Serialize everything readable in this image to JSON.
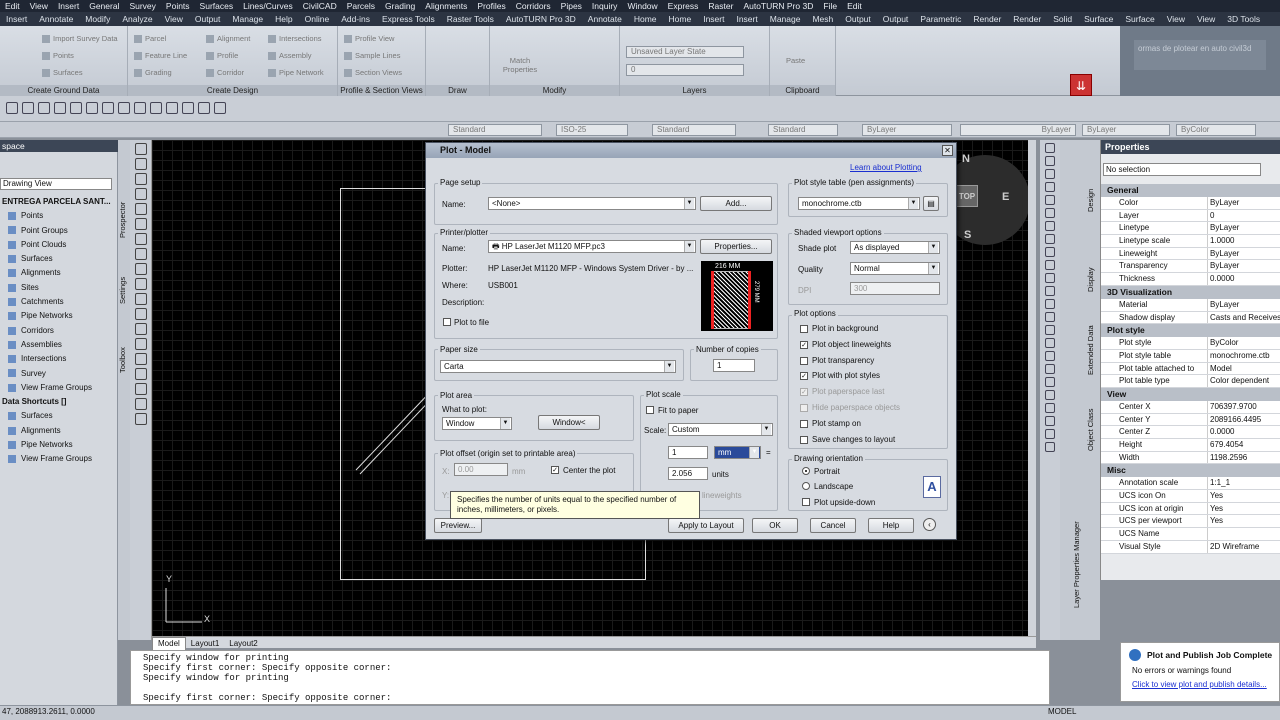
{
  "menubar": [
    "Edit",
    "View",
    "Insert",
    "General",
    "Survey",
    "Points",
    "Surfaces",
    "Lines/Curves",
    "CivilCAD",
    "Parcels",
    "Grading",
    "Alignments",
    "Profiles",
    "Corridors",
    "Pipes",
    "Inquiry",
    "Window",
    "Express",
    "Raster",
    "AutoTURN Pro 3D",
    "File",
    "Edit"
  ],
  "ribbon_tabs": [
    "Insert",
    "Annotate",
    "Modify",
    "Analyze",
    "View",
    "Output",
    "Manage",
    "Help",
    "Online",
    "Add-ins",
    "Express Tools",
    "Raster Tools",
    "AutoTURN Pro 3D",
    "Annotate",
    "Home",
    "Home",
    "Insert",
    "Insert",
    "Manage",
    "Mesh",
    "Output",
    "Output",
    "Parametric",
    "Render",
    "Render",
    "Solid",
    "Surface",
    "Surface",
    "View",
    "View",
    "3D Tools"
  ],
  "ribbon": {
    "g1_items": [
      "Import Survey Data",
      "Points",
      "Surfaces"
    ],
    "g1_title": "Create Ground Data",
    "g2_items": [
      "Parcel",
      "Feature Line",
      "Grading",
      "Alignment",
      "Profile",
      "Corridor",
      "Intersections",
      "Assembly",
      "Pipe Network"
    ],
    "g2_title": "Create Design",
    "g3_items": [
      "Profile View",
      "Sample Lines",
      "Section Views"
    ],
    "g3_title": "Profile & Section Views",
    "g4_title": "Draw",
    "g5_items": [
      "Match Properties"
    ],
    "g5_title": "Modify",
    "g6_items": [
      "Unsaved Layer State",
      "0"
    ],
    "g6_title": "Layers",
    "g7_items": [
      "Paste"
    ],
    "g7_title": "Clipboard",
    "help_text": "ormas de plotear en auto civil3d"
  },
  "toolbar3": {
    "textstyle": "Standard",
    "dimstyle": "ISO-25",
    "tablestyle": "Standard",
    "mlstyle": "Standard",
    "layer": "ByLayer",
    "linetype": "ByLayer",
    "lineweight": "ByLayer",
    "plotstyle": "ByColor"
  },
  "leftpanel": {
    "title": "space",
    "view": "Drawing View",
    "vtabs": [
      "Prospector",
      "Settings",
      "Toolbox"
    ],
    "tree": [
      {
        "label": "ENTREGA PARCELA SANT...",
        "root": true
      },
      {
        "label": "Points"
      },
      {
        "label": "Point Groups"
      },
      {
        "label": "Point Clouds"
      },
      {
        "label": "Surfaces"
      },
      {
        "label": "Alignments"
      },
      {
        "label": "Sites"
      },
      {
        "label": "Catchments"
      },
      {
        "label": "Pipe Networks"
      },
      {
        "label": "Corridors"
      },
      {
        "label": "Assemblies"
      },
      {
        "label": "Intersections"
      },
      {
        "label": "Survey"
      },
      {
        "label": "View Frame Groups"
      },
      {
        "label": "Data Shortcuts []",
        "root": true
      },
      {
        "label": "Surfaces"
      },
      {
        "label": "Alignments"
      },
      {
        "label": "Pipe Networks"
      },
      {
        "label": "View Frame Groups"
      }
    ]
  },
  "compass": {
    "n": "N",
    "e": "E",
    "s": "S",
    "top": "TOP"
  },
  "layout_tabs": [
    "Model",
    "Layout1",
    "Layout2"
  ],
  "command_lines": [
    "Specify window for printing",
    "Specify first corner: Specify opposite corner:",
    "Specify window for printing",
    "",
    "Specify first corner: Specify opposite corner:"
  ],
  "status": {
    "coords": "47, 2088913.2611, 0.0000",
    "model": "MODEL"
  },
  "properties": {
    "title": "Properties",
    "selection": "No selection",
    "right_tabs": [
      "Design",
      "Display",
      "Extended Data",
      "Object Class",
      "Layer Properties Manager"
    ],
    "sections": [
      {
        "name": "General",
        "rows": [
          [
            "Color",
            "ByLayer"
          ],
          [
            "Layer",
            "0"
          ],
          [
            "Linetype",
            "ByLayer"
          ],
          [
            "Linetype scale",
            "1.0000"
          ],
          [
            "Lineweight",
            "ByLayer"
          ],
          [
            "Transparency",
            "ByLayer"
          ],
          [
            "Thickness",
            "0.0000"
          ]
        ]
      },
      {
        "name": "3D Visualization",
        "rows": [
          [
            "Material",
            "ByLayer"
          ],
          [
            "Shadow display",
            "Casts and Receives S"
          ]
        ]
      },
      {
        "name": "Plot style",
        "rows": [
          [
            "Plot style",
            "ByColor"
          ],
          [
            "Plot style table",
            "monochrome.ctb"
          ],
          [
            "Plot table attached to",
            "Model"
          ],
          [
            "Plot table type",
            "Color dependent"
          ]
        ]
      },
      {
        "name": "View",
        "rows": [
          [
            "Center X",
            "706397.9700"
          ],
          [
            "Center Y",
            "2089166.4495"
          ],
          [
            "Center Z",
            "0.0000"
          ],
          [
            "Height",
            "679.4054"
          ],
          [
            "Width",
            "1198.2596"
          ]
        ]
      },
      {
        "name": "Misc",
        "rows": [
          [
            "Annotation scale",
            "1:1_1"
          ],
          [
            "UCS icon On",
            "Yes"
          ],
          [
            "UCS icon at origin",
            "Yes"
          ],
          [
            "UCS per viewport",
            "Yes"
          ],
          [
            "UCS Name",
            ""
          ],
          [
            "Visual Style",
            "2D Wireframe"
          ]
        ]
      }
    ]
  },
  "notification": {
    "title": "Plot and Publish Job Complete",
    "message": "No errors or warnings found",
    "link": "Click to view plot and publish details..."
  },
  "dialog": {
    "title": "Plot - Model",
    "learn": "Learn about Plotting",
    "page_setup": {
      "title": "Page setup",
      "name_label": "Name:",
      "name": "<None>",
      "add": "Add..."
    },
    "printer": {
      "title": "Printer/plotter",
      "name_label": "Name:",
      "name": "HP LaserJet M1120 MFP.pc3",
      "properties": "Properties...",
      "plotter_label": "Plotter:",
      "plotter": "HP LaserJet M1120 MFP - Windows System Driver - by ...",
      "where_label": "Where:",
      "where": "USB001",
      "desc_label": "Description:",
      "plot_to_file": "Plot to file",
      "dim_w": "216 MM",
      "dim_h": "279 MM"
    },
    "paper": {
      "title": "Paper size",
      "value": "Carta"
    },
    "copies": {
      "title": "Number of copies",
      "value": "1"
    },
    "area": {
      "title": "Plot area",
      "what_label": "What to plot:",
      "what": "Window",
      "window_btn": "Window<"
    },
    "offset": {
      "title": "Plot offset (origin set to printable area)",
      "x_label": "X:",
      "x": "0.00",
      "x_unit": "mm",
      "y_label": "Y:",
      "center": "Center the plot"
    },
    "scale": {
      "title": "Plot scale",
      "fit": "Fit to paper",
      "scale_label": "Scale:",
      "scale": "Custom",
      "num": "1",
      "unit": "mm",
      "den": "2.056",
      "units_label": "units",
      "lw": "lineweights"
    },
    "tooltip": "Specifies the number of units equal to the specified number of inches, millimeters, or pixels.",
    "pst": {
      "title": "Plot style table (pen assignments)",
      "value": "monochrome.ctb"
    },
    "shaded": {
      "title": "Shaded viewport options",
      "shade_label": "Shade plot",
      "shade": "As displayed",
      "quality_label": "Quality",
      "quality": "Normal",
      "dpi_label": "DPI",
      "dpi": "300"
    },
    "options": {
      "title": "Plot options",
      "items": [
        {
          "label": "Plot in background",
          "checked": false,
          "dis": false
        },
        {
          "label": "Plot object lineweights",
          "checked": true,
          "dis": false
        },
        {
          "label": "Plot transparency",
          "checked": false,
          "dis": false
        },
        {
          "label": "Plot with plot styles",
          "checked": true,
          "dis": false
        },
        {
          "label": "Plot paperspace last",
          "checked": true,
          "dis": true
        },
        {
          "label": "Hide paperspace objects",
          "checked": false,
          "dis": true
        },
        {
          "label": "Plot stamp on",
          "checked": false,
          "dis": false
        },
        {
          "label": "Save changes to layout",
          "checked": false,
          "dis": false
        }
      ]
    },
    "orient": {
      "title": "Drawing orientation",
      "portrait": "Portrait",
      "landscape": "Landscape",
      "upside": "Plot upside-down",
      "icon": "A"
    },
    "buttons": {
      "preview": "Preview...",
      "apply": "Apply to Layout",
      "ok": "OK",
      "cancel": "Cancel",
      "help": "Help"
    }
  }
}
